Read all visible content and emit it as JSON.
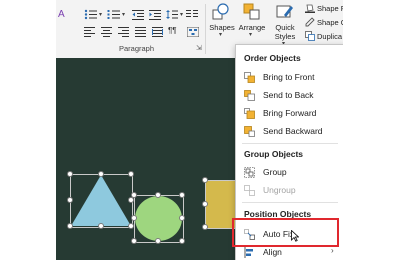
{
  "ribbon": {
    "paragraph_group_label": "Paragraph",
    "shapes_label": "Shapes",
    "arrange_label": "Arrange",
    "quick_styles_label_line1": "Quick",
    "quick_styles_label_line2": "Styles",
    "shape_fill_label": "Shape F",
    "shape_outline_label": "Shape O",
    "duplicate_label": "Duplica"
  },
  "menu": {
    "order_header": "Order Objects",
    "order_items": [
      {
        "label": "Bring to Front",
        "icon": "bring-to-front-icon",
        "enabled": true
      },
      {
        "label": "Send to Back",
        "icon": "send-to-back-icon",
        "enabled": true
      },
      {
        "label": "Bring Forward",
        "icon": "bring-forward-icon",
        "enabled": true
      },
      {
        "label": "Send Backward",
        "icon": "send-backward-icon",
        "enabled": true
      }
    ],
    "group_header": "Group Objects",
    "group_items": [
      {
        "label": "Group",
        "icon": "group-icon",
        "enabled": true
      },
      {
        "label": "Ungroup",
        "icon": "ungroup-icon",
        "enabled": false
      }
    ],
    "position_header": "Position Objects",
    "position_items": [
      {
        "label": "Auto Fix",
        "icon": "auto-fix-icon",
        "enabled": true
      },
      {
        "label": "Align",
        "icon": "align-icon",
        "enabled": true
      }
    ]
  },
  "colors": {
    "canvas": "#263a33",
    "triangle": "#8ec9de",
    "circle": "#9ed67f",
    "rectangle": "#d4b94c",
    "menu_icon_accent": "#f2b233",
    "highlight_border": "#e0282e"
  }
}
